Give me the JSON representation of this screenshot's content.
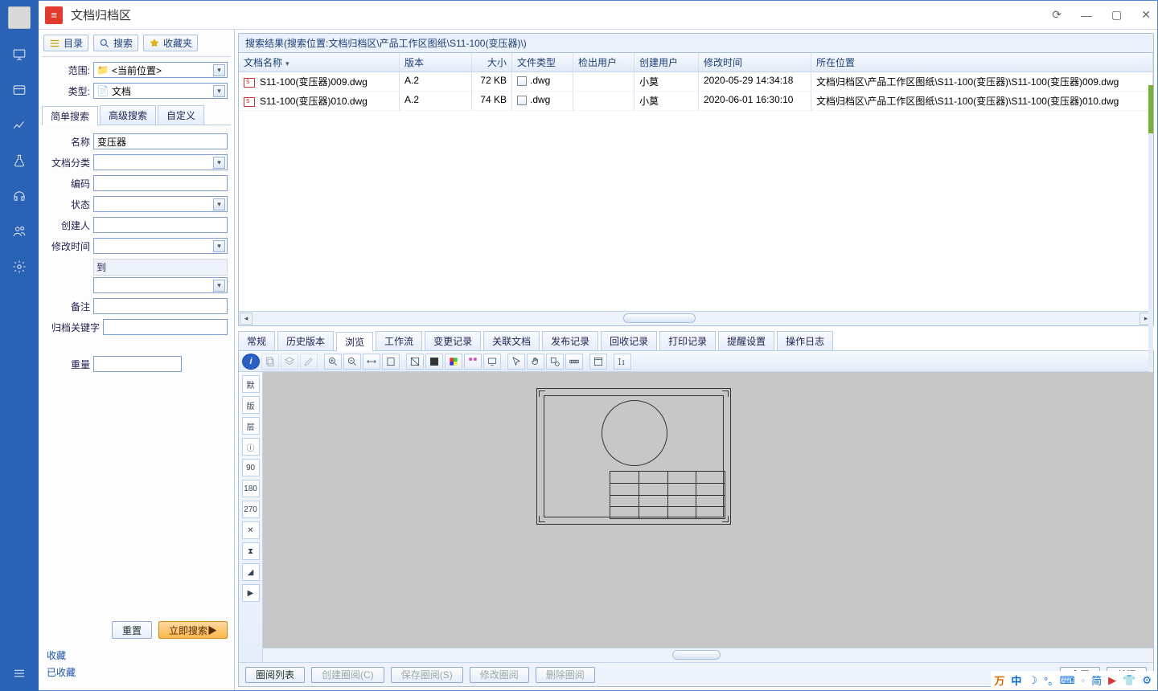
{
  "title": "文档归档区",
  "winctrls": {
    "refresh": "⟳",
    "min": "—",
    "max": "▢",
    "close": "✕"
  },
  "leftTabs": {
    "catalog": "目录",
    "search": "搜索",
    "favorites": "收藏夹"
  },
  "scope": {
    "label": "范围:",
    "value": "<当前位置>"
  },
  "type": {
    "label": "类型:",
    "value": "文档"
  },
  "searchModes": {
    "simple": "简单搜索",
    "advanced": "高级搜索",
    "custom": "自定义"
  },
  "fields": {
    "name": {
      "label": "名称",
      "value": "变压器"
    },
    "docClass": {
      "label": "文档分类",
      "value": ""
    },
    "code": {
      "label": "编码",
      "value": ""
    },
    "status": {
      "label": "状态",
      "value": ""
    },
    "creator": {
      "label": "创建人",
      "value": ""
    },
    "mtime": {
      "label": "修改时间",
      "value": "",
      "to_label": "到",
      "value2": ""
    },
    "remark": {
      "label": "备注",
      "value": ""
    },
    "archiveKey": {
      "label": "归档关键字",
      "value": ""
    },
    "weight": {
      "label": "重量",
      "value": ""
    }
  },
  "lpButtons": {
    "reset": "重置",
    "searchNow": "立即搜索"
  },
  "fav": {
    "fav": "收藏",
    "faved": "已收藏"
  },
  "resultHeader": "搜索结果(搜索位置:文档归档区\\产品工作区图纸\\S11-100(变压器)\\)",
  "columns": {
    "name": "文档名称",
    "ver": "版本",
    "size": "大小",
    "ftype": "文件类型",
    "cout": "检出用户",
    "creator": "创建用户",
    "mtime": "修改时间",
    "loc": "所在位置"
  },
  "rows": [
    {
      "name": "S11-100(变压器)009.dwg",
      "ver": "A.2",
      "size": "72 KB",
      "ftype": ".dwg",
      "cout": "",
      "creator": "小莫",
      "mtime": "2020-05-29 14:34:18",
      "loc": "文档归档区\\产品工作区图纸\\S11-100(变压器)\\S11-100(变压器)009.dwg"
    },
    {
      "name": "S11-100(变压器)010.dwg",
      "ver": "A.2",
      "size": "74 KB",
      "ftype": ".dwg",
      "cout": "",
      "creator": "小莫",
      "mtime": "2020-06-01 16:30:10",
      "loc": "文档归档区\\产品工作区图纸\\S11-100(变压器)\\S11-100(变压器)010.dwg"
    }
  ],
  "detailTabs": {
    "general": "常规",
    "history": "历史版本",
    "preview": "浏览",
    "workflow": "工作流",
    "changeLog": "变更记录",
    "related": "关联文档",
    "publish": "发布记录",
    "recycle": "回收记录",
    "print": "打印记录",
    "remind": "提醒设置",
    "oplog": "操作日志"
  },
  "sideTools": [
    "默",
    "版",
    "层",
    "ⓘ",
    "90",
    "180",
    "270",
    "✕",
    "⧗",
    "◢",
    "▶"
  ],
  "markup": {
    "list": "圈阅列表",
    "create": "创建圈阅(C)",
    "save": "保存圈阅(S)",
    "edit": "修改圈阅",
    "del": "删除圈阅",
    "full": "全屏",
    "close": "关闭"
  },
  "tray": {
    "han": "万",
    "cn": "中",
    "moon": "☽",
    "deg": "°｡",
    "kb": "⌨",
    "per": "◦",
    "simp": "简",
    "cam": "▶",
    "shirt": "👕",
    "gear": "⚙"
  },
  "searchNowIcon": "▶"
}
